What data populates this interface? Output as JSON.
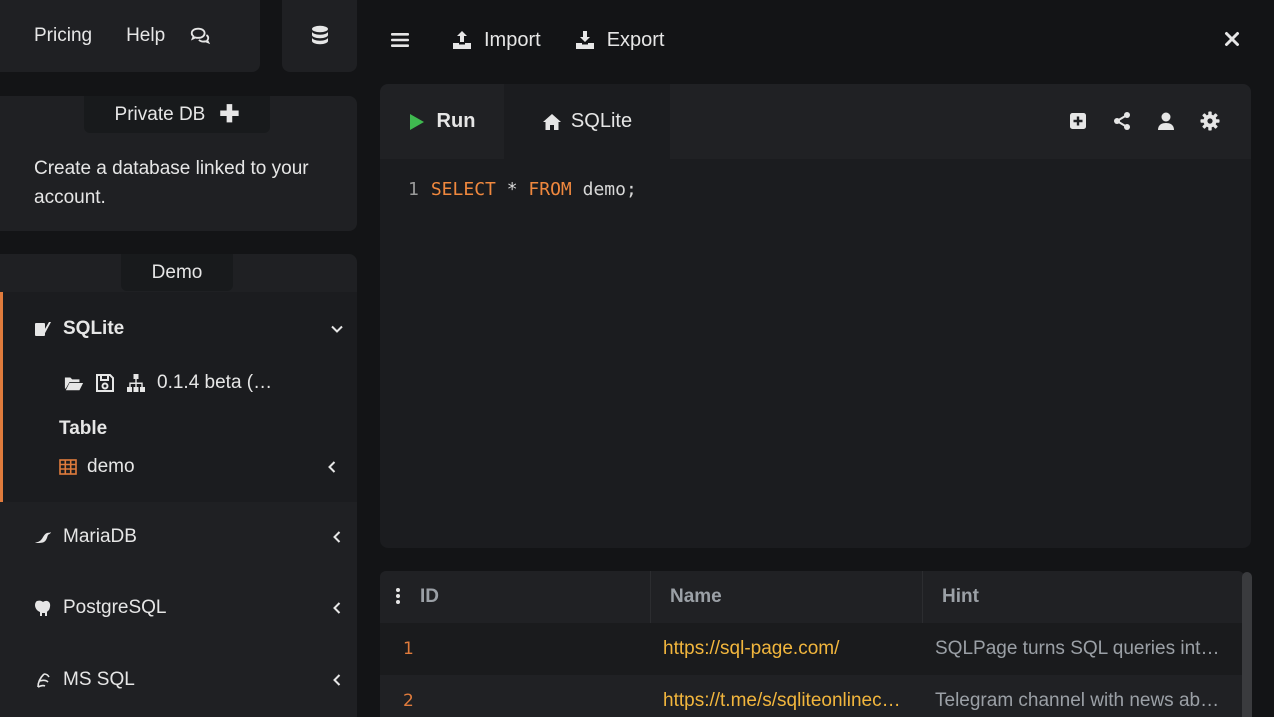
{
  "topnav": {
    "pricing": "Pricing",
    "help": "Help",
    "chat_icon": "comments-icon",
    "db_icon": "database-icon"
  },
  "private_db": {
    "tab_label": "Private DB",
    "add_icon": "plus-icon",
    "description": "Create a database linked to your account."
  },
  "demo": {
    "tab_label": "Demo",
    "sqlite": {
      "label": "SQLite",
      "version": "0.1.4 beta (…",
      "table_heading": "Table",
      "table_name": "demo"
    },
    "databases": [
      {
        "label": "MariaDB",
        "icon": "seal-icon"
      },
      {
        "label": "PostgreSQL",
        "icon": "elephant-icon"
      },
      {
        "label": "MS SQL",
        "icon": "mssql-icon"
      }
    ]
  },
  "toolbar": {
    "import": "Import",
    "export": "Export"
  },
  "editor": {
    "run_label": "Run",
    "tab_label": "SQLite",
    "code": {
      "line": "1",
      "kw1": "SELECT",
      "op": "*",
      "kw2": "FROM",
      "ident": "demo;"
    }
  },
  "results": {
    "columns": [
      "ID",
      "Name",
      "Hint"
    ],
    "rows": [
      {
        "id": "1",
        "name": "https://sql-page.com/",
        "hint": "SQLPage turns SQL queries int…"
      },
      {
        "id": "2",
        "name": "https://t.me/s/sqliteonlinec…",
        "hint": "Telegram channel with news ab…"
      }
    ]
  },
  "colors": {
    "accent": "#e07b3c",
    "link": "#f2b63d",
    "run": "#3fb950",
    "bg": "#131416",
    "panel": "#1f2023"
  }
}
